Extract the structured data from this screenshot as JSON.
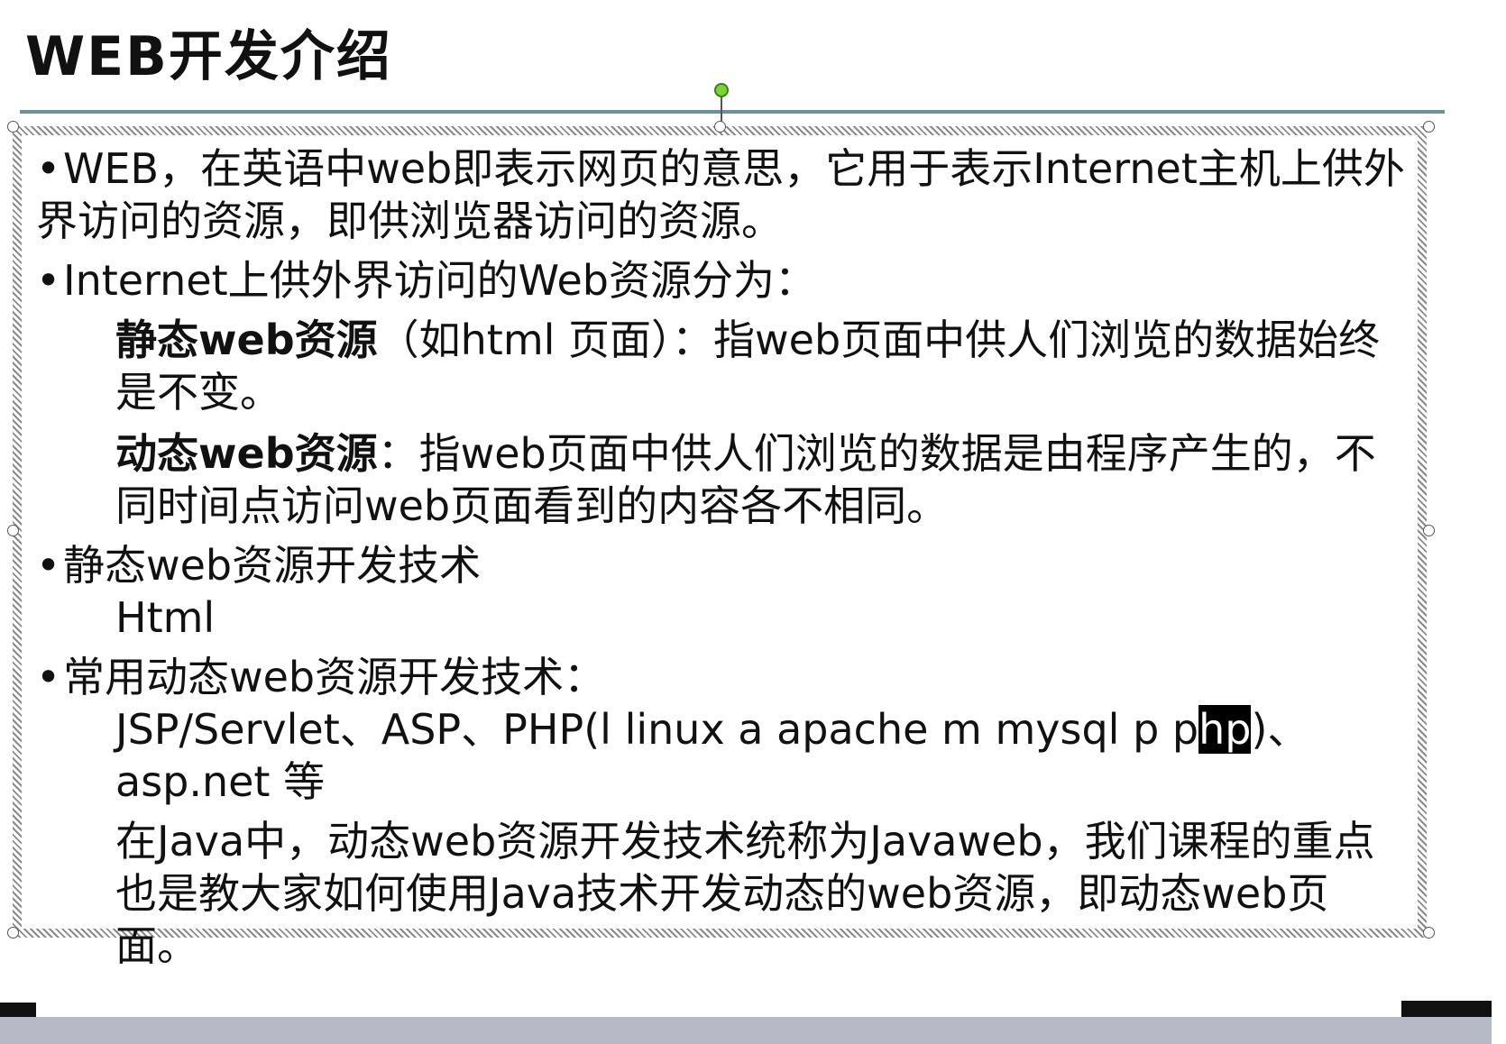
{
  "slide": {
    "title": "WEB开发介绍",
    "bullets": [
      {
        "marker": "•",
        "text": "WEB，在英语中web即表示网页的意思，它用于表示Internet主机上供外界访问的资源，即供浏览器访问的资源。"
      },
      {
        "marker": "•",
        "text": "Internet上供外界访问的Web资源分为："
      }
    ],
    "static_resource": {
      "bold_label": "静态web资源",
      "text": "（如html 页面）：指web页面中供人们浏览的数据始终是不变。"
    },
    "dynamic_resource": {
      "bold_label": "动态web资源",
      "text": "：指web页面中供人们浏览的数据是由程序产生的，不同时间点访问web页面看到的内容各不相同。"
    },
    "static_tech": {
      "marker": "•",
      "heading": "静态web资源开发技术",
      "item": "Html"
    },
    "dynamic_tech": {
      "marker": "•",
      "heading": "常用动态web资源开发技术：",
      "line_prefix": "JSP/Servlet、ASP、PHP(l linux a apache m mysql p p",
      "line_highlight": "hp",
      "line_suffix": ")、",
      "line2": "asp.net 等",
      "java_note": "在Java中，动态web资源开发技术统称为Javaweb，我们课程的重点也是教大家如何使用Java技术开发动态的web资源，即动态web页面。"
    }
  }
}
